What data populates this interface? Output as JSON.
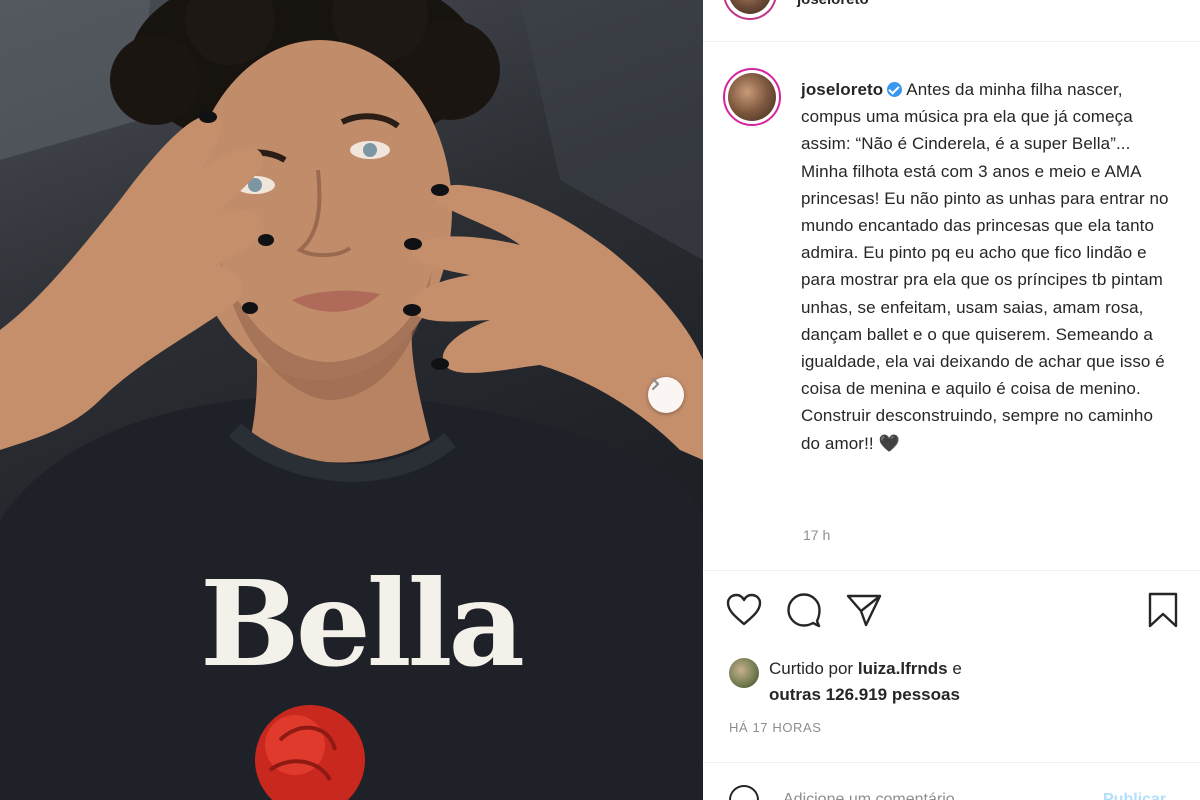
{
  "post": {
    "shirt_text": "Bella"
  },
  "header": {
    "username": "joseloreto"
  },
  "caption": {
    "username": "joseloreto",
    "text": "Antes da minha filha nascer, compus uma música pra ela que já começa assim: “Não é Cinderela, é a super Bella”... Minha filhota está com 3 anos e meio e AMA princesas! Eu não pinto as unhas para entrar no mundo encantado das princesas que ela tanto admira. Eu pinto pq eu acho que fico lindão e para mostrar pra ela que os príncipes tb pintam unhas, se enfeitam, usam saias, amam rosa, dançam ballet e o que quiserem. Semeando a igualdade, ela vai deixando de achar que isso é coisa de menina e aquilo é coisa de menino. Construir desconstruindo, sempre no caminho do amor!! 🖤",
    "time": "17 h"
  },
  "actions": {
    "icons": [
      "heart-icon",
      "comment-icon",
      "share-icon",
      "bookmark-icon"
    ]
  },
  "likes": {
    "prefix": "Curtido por",
    "user": "luiza.lfrnds",
    "connector": "e",
    "others": "outras 126.919 pessoas"
  },
  "timestamp": "HÁ 17 HORAS",
  "comment": {
    "placeholder": "Adicione um comentário...",
    "publish_label": "Publicar"
  },
  "colors": {
    "verified": "#3897f0",
    "story_ring": "#d6249f",
    "publish_disabled": "#b2dffc",
    "muted": "#8e8e8e"
  }
}
